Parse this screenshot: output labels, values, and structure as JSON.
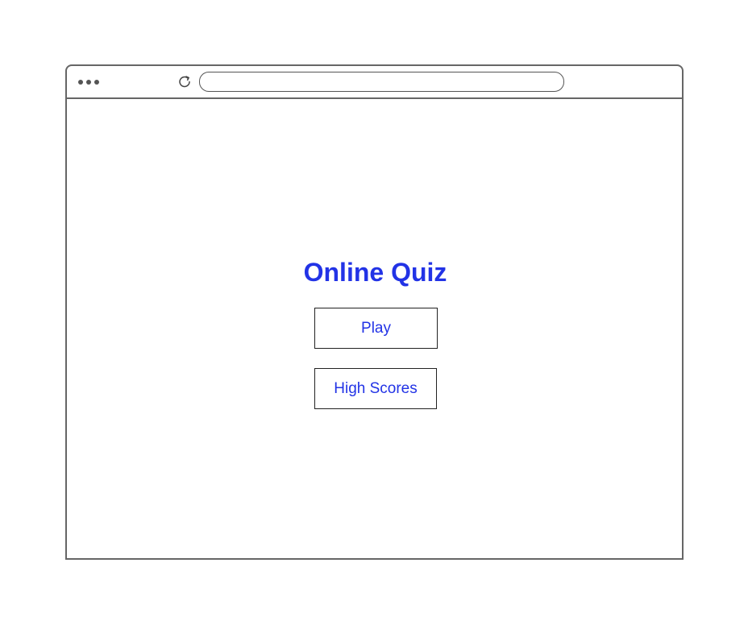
{
  "browser": {
    "menu_icon": "ellipsis-icon",
    "reload_icon": "reload-icon",
    "address_value": ""
  },
  "page": {
    "title": "Online Quiz",
    "buttons": {
      "play_label": "Play",
      "high_scores_label": "High Scores"
    }
  },
  "colors": {
    "accent": "#2233e6",
    "frame": "#666666"
  }
}
